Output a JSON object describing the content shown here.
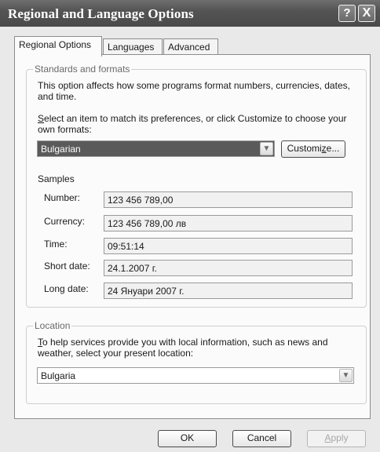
{
  "window": {
    "title": "Regional and Language Options",
    "help_glyph": "?",
    "close_glyph": "X"
  },
  "tabs": [
    {
      "label": "Regional Options",
      "active": true
    },
    {
      "label": "Languages",
      "active": false
    },
    {
      "label": "Advanced",
      "active": false
    }
  ],
  "standards": {
    "legend": "Standards and formats",
    "description": "This option affects how some programs format numbers, currencies, dates, and time.",
    "select_hotkey": "S",
    "select_prompt": "elect an item to match its preferences, or click Customize to choose your own formats:",
    "format_value": "Bulgarian",
    "customize_before": "Customi",
    "customize_hotkey": "z",
    "customize_after": "e..."
  },
  "samples": {
    "heading": "Samples",
    "rows": [
      {
        "label": "Number:",
        "value": "123 456 789,00"
      },
      {
        "label": "Currency:",
        "value": "123 456 789,00 лв"
      },
      {
        "label": "Time:",
        "value": "09:51:14"
      },
      {
        "label": "Short date:",
        "value": "24.1.2007 г."
      },
      {
        "label": "Long date:",
        "value": "24 Януари 2007 г."
      }
    ]
  },
  "location": {
    "legend": "Location",
    "hotkey": "T",
    "description": "o help services provide you with local information, such as news and weather, select your present location:",
    "value": "Bulgaria"
  },
  "buttons": {
    "ok": "OK",
    "cancel": "Cancel",
    "apply_hotkey": "A",
    "apply_rest": "pply"
  }
}
